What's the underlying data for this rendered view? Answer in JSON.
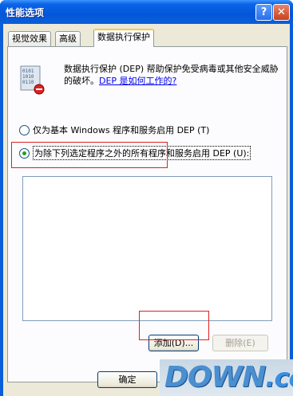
{
  "window": {
    "title": "性能选项",
    "help_glyph": "?",
    "close_glyph": "✕"
  },
  "tabs": [
    {
      "label": "视觉效果",
      "active": false
    },
    {
      "label": "高级",
      "active": false
    },
    {
      "label": "数据执行保护",
      "active": true
    }
  ],
  "dep": {
    "description": "数据执行保护 (DEP) 帮助保护免受病毒或其他安全威胁的破坏。",
    "link": "DEP 是如何工作的?",
    "option1": "仅为基本 Windows 程序和服务启用 DEP (T)",
    "option2": "为除下列选定程序之外的所有程序和服务启用 DEP (U):",
    "selected_option": 2
  },
  "buttons": {
    "add": "添加(D)...",
    "remove": "删除(E)",
    "ok": "确定"
  },
  "watermark": {
    "main": "DOWN",
    "suffix": ".cc"
  },
  "colors": {
    "title_blue": "#0a5fd8",
    "face": "#ece9d8",
    "highlight_box": "#e02020"
  }
}
